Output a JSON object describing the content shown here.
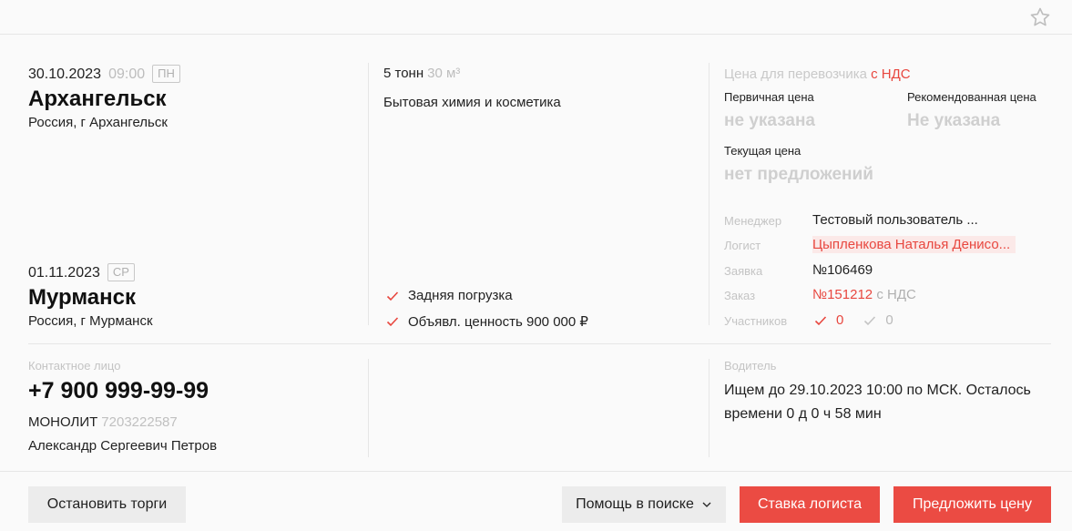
{
  "favorite": {
    "icon": "star-icon"
  },
  "route": {
    "origin": {
      "date": "30.10.2023",
      "time": "09:00",
      "day": "ПН",
      "city": "Архангельск",
      "region": "Россия, г Архангельск"
    },
    "destination": {
      "date": "01.11.2023",
      "time": "",
      "day": "СР",
      "city": "Мурманск",
      "region": "Россия, г Мурманск"
    }
  },
  "cargo": {
    "weight": "5 тонн",
    "volume": "30 м³",
    "description": "Бытовая химия и косметика",
    "features": [
      "Задняя погрузка",
      "Объявл. ценность 900 000 ₽"
    ]
  },
  "price": {
    "title": "Цена для перевозчика",
    "vat": "с НДС",
    "initial_label": "Первичная цена",
    "initial_value": "не указана",
    "recommended_label": "Рекомендованная цена",
    "recommended_value": "Не указана",
    "current_label": "Текущая цена",
    "current_value": "нет предложений"
  },
  "meta": {
    "manager_label": "Менеджер",
    "manager_value": "Тестовый пользователь ...",
    "logist_label": "Логист",
    "logist_value": "Цыпленкова Наталья Денисо...",
    "request_label": "Заявка",
    "request_value": "№106469",
    "order_label": "Заказ",
    "order_number": "№151212",
    "order_vat": "с НДС",
    "participants_label": "Участников",
    "participants_confirmed": "0",
    "participants_other": "0"
  },
  "contact": {
    "label": "Контактное лицо",
    "phone": "+7 900 999-99-99",
    "company": "МОНОЛИТ",
    "inn": "7203222587",
    "person": "Александр Сергеевич Петров"
  },
  "driver": {
    "label": "Водитель",
    "text": "Ищем до 29.10.2023 10:00 по МСК. Осталось времени 0 д 0 ч 58 мин"
  },
  "actions": {
    "stop": "Остановить торги",
    "help": "Помощь в поиске",
    "logist_bid": "Ставка логиста",
    "offer": "Предложить цену"
  },
  "colors": {
    "accent": "#eb4b43",
    "muted": "#c4c4c4",
    "border": "#e6e6e6"
  }
}
